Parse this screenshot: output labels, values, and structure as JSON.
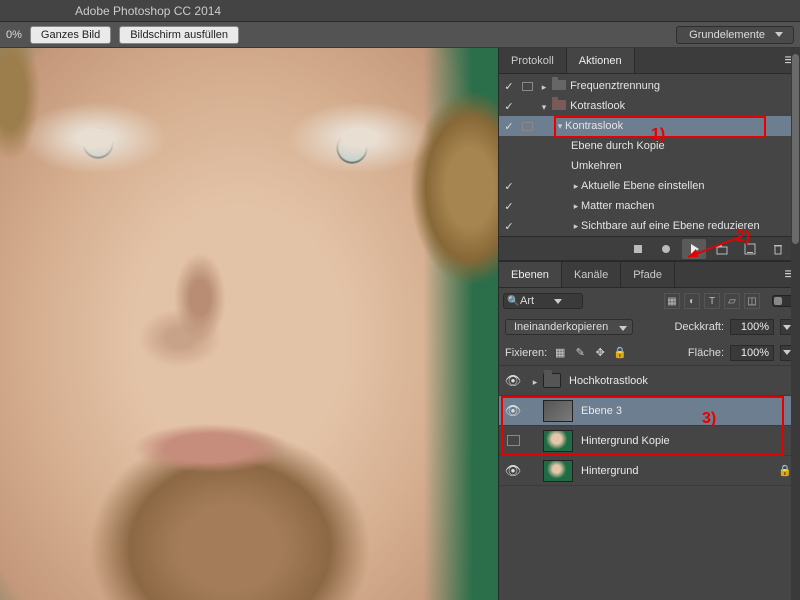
{
  "app": {
    "title": "Adobe Photoshop CC 2014"
  },
  "toolbar": {
    "zoom": "0%",
    "fit_screen": "Ganzes Bild",
    "fill_screen": "Bildschirm ausfüllen",
    "workspace": "Grundelemente"
  },
  "actions_panel": {
    "tabs": {
      "protocol": "Protokoll",
      "actions": "Aktionen"
    },
    "items": [
      {
        "checked": true,
        "dlg": true,
        "depth": 1,
        "expand": "closed",
        "icon": "folder",
        "label": "Frequenztrennung"
      },
      {
        "checked": true,
        "dlg": false,
        "depth": 1,
        "expand": "open",
        "icon": "folder-open",
        "label": "Kotrastlook"
      },
      {
        "checked": true,
        "dlg": true,
        "depth": 2,
        "expand": "open",
        "icon": "",
        "label": "Kontraslook",
        "selected": true
      },
      {
        "checked": false,
        "dlg": false,
        "depth": 3,
        "expand": "",
        "icon": "",
        "label": "Ebene durch Kopie"
      },
      {
        "checked": false,
        "dlg": false,
        "depth": 3,
        "expand": "",
        "icon": "",
        "label": "Umkehren"
      },
      {
        "checked": true,
        "dlg": false,
        "depth": 3,
        "expand": "closed",
        "icon": "",
        "label": "Aktuelle Ebene einstellen"
      },
      {
        "checked": true,
        "dlg": false,
        "depth": 3,
        "expand": "closed",
        "icon": "",
        "label": "Matter machen"
      },
      {
        "checked": true,
        "dlg": false,
        "depth": 3,
        "expand": "closed",
        "icon": "",
        "label": "Sichtbare auf eine Ebene reduzieren"
      }
    ]
  },
  "layers_panel": {
    "tabs": {
      "layers": "Ebenen",
      "channels": "Kanäle",
      "paths": "Pfade"
    },
    "filter_kind": "Art",
    "blend_mode": "Ineinanderkopieren",
    "opacity_label": "Deckkraft:",
    "opacity_value": "100%",
    "lock_label": "Fixieren:",
    "fill_label": "Fläche:",
    "fill_value": "100%",
    "layers": [
      {
        "vis": true,
        "type": "group",
        "name": "Hochkotrastlook",
        "selected": false
      },
      {
        "vis": true,
        "type": "layer",
        "thumb": "gray",
        "name": "Ebene 3",
        "selected": true
      },
      {
        "vis": false,
        "type": "layer",
        "thumb": "grn",
        "name": "Hintergrund Kopie",
        "selected": false
      },
      {
        "vis": true,
        "type": "layer",
        "thumb": "grn2",
        "name": "Hintergrund",
        "selected": false,
        "locked": true
      }
    ]
  },
  "annotations": {
    "a1": "1)",
    "a2": "2)",
    "a3": "3)"
  }
}
